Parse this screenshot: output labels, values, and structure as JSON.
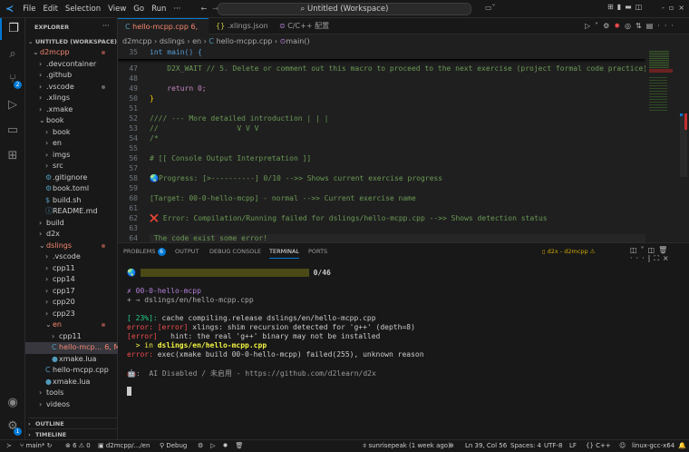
{
  "titlebar": {
    "menus": [
      "File",
      "Edit",
      "Selection",
      "View",
      "Go",
      "Run",
      "···"
    ],
    "search": "Untitled (Workspace)"
  },
  "activity": {
    "scm_badge": "2",
    "settings_badge": "1"
  },
  "sidebar": {
    "title": "EXPLORER",
    "workspace": "UNTITLED (WORKSPACE)",
    "items": [
      {
        "label": "d2mcpp",
        "indent": 0,
        "type": "open",
        "modified": true
      },
      {
        "label": ".devcontainer",
        "indent": 1,
        "type": "closed"
      },
      {
        "label": ".github",
        "indent": 1,
        "type": "closed"
      },
      {
        "label": ".vscode",
        "indent": 1,
        "type": "closed",
        "dot": true
      },
      {
        "label": ".xlings",
        "indent": 1,
        "type": "closed"
      },
      {
        "label": ".xmake",
        "indent": 1,
        "type": "closed"
      },
      {
        "label": "book",
        "indent": 1,
        "type": "open"
      },
      {
        "label": "book",
        "indent": 2,
        "type": "closed"
      },
      {
        "label": "en",
        "indent": 2,
        "type": "closed"
      },
      {
        "label": "imgs",
        "indent": 2,
        "type": "closed"
      },
      {
        "label": "src",
        "indent": 2,
        "type": "closed"
      },
      {
        "label": ".gitignore",
        "indent": 2,
        "type": "file"
      },
      {
        "label": "book.toml",
        "indent": 2,
        "type": "file"
      },
      {
        "label": "build.sh",
        "indent": 2,
        "type": "file"
      },
      {
        "label": "README.md",
        "indent": 2,
        "type": "file"
      },
      {
        "label": "build",
        "indent": 1,
        "type": "closed"
      },
      {
        "label": "d2x",
        "indent": 1,
        "type": "closed"
      },
      {
        "label": "dslings",
        "indent": 1,
        "type": "open",
        "modified": true
      },
      {
        "label": ".vscode",
        "indent": 2,
        "type": "closed"
      },
      {
        "label": "cpp11",
        "indent": 2,
        "type": "closed"
      },
      {
        "label": "cpp14",
        "indent": 2,
        "type": "closed"
      },
      {
        "label": "cpp17",
        "indent": 2,
        "type": "closed"
      },
      {
        "label": "cpp20",
        "indent": 2,
        "type": "closed"
      },
      {
        "label": "cpp23",
        "indent": 2,
        "type": "closed"
      },
      {
        "label": "en",
        "indent": 2,
        "type": "open",
        "modified": true
      },
      {
        "label": "cpp11",
        "indent": 3,
        "type": "closed"
      },
      {
        "label": "hello-mcp...",
        "indent": 3,
        "type": "file",
        "status": "6, M",
        "selected": true
      },
      {
        "label": "xmake.lua",
        "indent": 3,
        "type": "file"
      },
      {
        "label": "hello-mcpp.cpp",
        "indent": 2,
        "type": "file"
      },
      {
        "label": "xmake.lua",
        "indent": 2,
        "type": "file"
      },
      {
        "label": "tools",
        "indent": 1,
        "type": "closed"
      },
      {
        "label": "videos",
        "indent": 1,
        "type": "closed"
      }
    ],
    "outline": "OUTLINE",
    "timeline": "TIMELINE"
  },
  "tabs": [
    {
      "label": "hello-mcpp.cpp",
      "status": "6, M",
      "active": true,
      "icon": "C"
    },
    {
      "label": ".xlings.json",
      "icon": "{}"
    },
    {
      "label": "C/C++ 配置",
      "icon": "≡"
    }
  ],
  "breadcrumb": [
    "d2mcpp",
    "dslings",
    "en",
    "hello-mcpp.cpp",
    "main()"
  ],
  "editor": {
    "sticky": {
      "num": "35",
      "text": "int main() {"
    },
    "lines": [
      {
        "num": "47",
        "text": "    D2X_WAIT // 5. Delete or comment out this macro to proceed to the next exercise (project formal code practice)"
      },
      {
        "num": "48",
        "text": ""
      },
      {
        "num": "49",
        "text": "    return 0;"
      },
      {
        "num": "50",
        "text": "}"
      },
      {
        "num": "51",
        "text": ""
      },
      {
        "num": "52",
        "text": "//// --- More detailed introduction | | |"
      },
      {
        "num": "53",
        "text": "//                  V V V"
      },
      {
        "num": "54",
        "text": "/*"
      },
      {
        "num": "55",
        "text": ""
      },
      {
        "num": "56",
        "text": "# [[ Console Output Interpretation ]]"
      },
      {
        "num": "57",
        "text": ""
      },
      {
        "num": "58",
        "text": "🌏Progress: [>----------] 0/10 -->> Shows current exercise progress"
      },
      {
        "num": "59",
        "text": ""
      },
      {
        "num": "60",
        "text": "[Target: 00-0-hello-mcpp] - normal -->> Current exercise name"
      },
      {
        "num": "61",
        "text": ""
      },
      {
        "num": "62",
        "text": "❌ Error: Compilation/Running failed for dslings/hello-mcpp.cpp -->> Shows detection status"
      },
      {
        "num": "63",
        "text": ""
      },
      {
        "num": "64",
        "text": " The code exist some error!"
      }
    ]
  },
  "panel": {
    "tabs": [
      "PROBLEMS",
      "OUTPUT",
      "DEBUG CONSOLE",
      "TERMINAL",
      "PORTS"
    ],
    "problems_count": "6",
    "active": "TERMINAL",
    "terminal_name": "d2x - d2mcpp",
    "terminal": {
      "progress": "0/46",
      "progress_fraction": 0,
      "target": "✗ 00-0-hello-mcpp",
      "file": "+ → dslings/en/hello-mcpp.cpp",
      "pct": "[ 23%]:",
      "compile": " cache compiling.release dslings/en/hello-mcpp.cpp",
      "err1_a": "error:",
      "err1_b": " [error]",
      "err1_c": " xlings: shim recursion detected for 'g++' (depth=8)",
      "err2_a": "[error]",
      "err2_b": "   hint: the real 'g++' binary may not be installed",
      "in_a": "  > in ",
      "in_b": "dslings/en/hello-mcpp.cpp",
      "err3_a": "error:",
      "err3_b": " exec(xmake build 00-0-hello-mcpp) failed(255), unknown reason",
      "ai": "  AI Disabled / 未启用 - https://github.com/d2learn/d2x"
    }
  },
  "status": {
    "branch": "main*",
    "errors": "6",
    "warnings": "0",
    "folder": "d2mcpp/.../en",
    "debug": "Debug",
    "blame": "sunrisepeak (1 week ago)",
    "position": "Ln 39, Col 56",
    "spaces": "Spaces: 4",
    "encoding": "UTF-8",
    "eol": "LF",
    "language": "C++",
    "config": "linux-gcc-x64"
  },
  "colors": {
    "accent": "#0078d4",
    "error": "#f14c4c",
    "modified": "#f48771",
    "comment": "#6a9955"
  }
}
